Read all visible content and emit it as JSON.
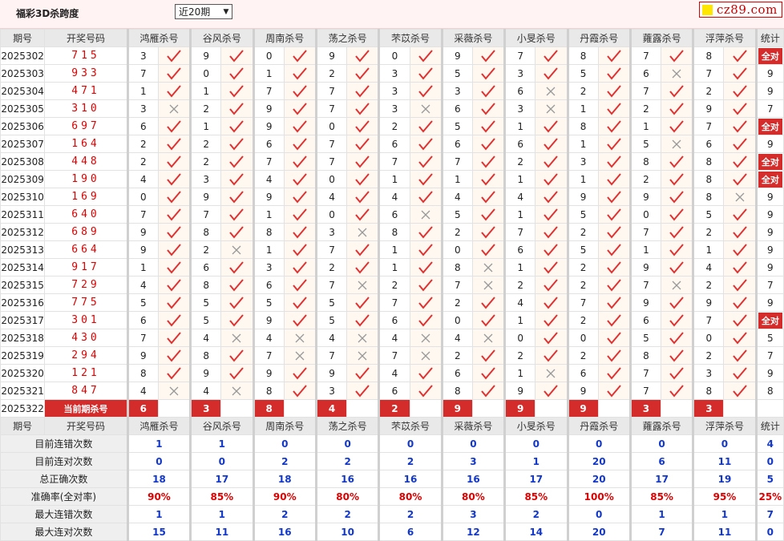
{
  "header": {
    "title": "福彩3D杀跨度",
    "period_select": "近20期",
    "logo_text": "cz89.com"
  },
  "columns": {
    "period": "期号",
    "draw": "开奖号码",
    "experts": [
      "鸿雁杀号",
      "谷风杀号",
      "周南杀号",
      "荡之杀号",
      "芣苡杀号",
      "采薇杀号",
      "小旻杀号",
      "丹霞杀号",
      "蕹露杀号",
      "浮萍杀号"
    ],
    "stat": "统计"
  },
  "rows": [
    {
      "period": "2025302",
      "draw": "715",
      "kills": [
        3,
        9,
        0,
        9,
        0,
        9,
        7,
        8,
        7,
        8
      ],
      "hits": [
        1,
        1,
        1,
        1,
        1,
        1,
        1,
        1,
        1,
        1
      ],
      "stat": "全对"
    },
    {
      "period": "2025303",
      "draw": "933",
      "kills": [
        7,
        0,
        1,
        2,
        3,
        5,
        3,
        5,
        6,
        7
      ],
      "hits": [
        1,
        1,
        1,
        1,
        1,
        1,
        1,
        1,
        0,
        1
      ],
      "stat": "9"
    },
    {
      "period": "2025304",
      "draw": "471",
      "kills": [
        1,
        1,
        7,
        7,
        3,
        3,
        6,
        2,
        7,
        2
      ],
      "hits": [
        1,
        1,
        1,
        1,
        1,
        1,
        0,
        1,
        1,
        1
      ],
      "stat": "9"
    },
    {
      "period": "2025305",
      "draw": "310",
      "kills": [
        3,
        2,
        9,
        7,
        3,
        6,
        3,
        1,
        2,
        9
      ],
      "hits": [
        0,
        1,
        1,
        1,
        0,
        1,
        0,
        1,
        1,
        1
      ],
      "stat": "7"
    },
    {
      "period": "2025306",
      "draw": "697",
      "kills": [
        6,
        1,
        9,
        0,
        2,
        5,
        1,
        8,
        1,
        7
      ],
      "hits": [
        1,
        1,
        1,
        1,
        1,
        1,
        1,
        1,
        1,
        1
      ],
      "stat": "全对"
    },
    {
      "period": "2025307",
      "draw": "164",
      "kills": [
        2,
        2,
        6,
        7,
        6,
        6,
        6,
        1,
        5,
        6
      ],
      "hits": [
        1,
        1,
        1,
        1,
        1,
        1,
        1,
        1,
        0,
        1
      ],
      "stat": "9"
    },
    {
      "period": "2025308",
      "draw": "448",
      "kills": [
        2,
        2,
        7,
        7,
        7,
        7,
        2,
        3,
        8,
        8
      ],
      "hits": [
        1,
        1,
        1,
        1,
        1,
        1,
        1,
        1,
        1,
        1
      ],
      "stat": "全对"
    },
    {
      "period": "2025309",
      "draw": "190",
      "kills": [
        4,
        3,
        4,
        0,
        1,
        1,
        1,
        1,
        2,
        8
      ],
      "hits": [
        1,
        1,
        1,
        1,
        1,
        1,
        1,
        1,
        1,
        1
      ],
      "stat": "全对"
    },
    {
      "period": "2025310",
      "draw": "169",
      "kills": [
        0,
        9,
        9,
        4,
        4,
        4,
        4,
        9,
        9,
        8
      ],
      "hits": [
        1,
        1,
        1,
        1,
        1,
        1,
        1,
        1,
        1,
        0
      ],
      "stat": "9"
    },
    {
      "period": "2025311",
      "draw": "640",
      "kills": [
        7,
        7,
        1,
        0,
        6,
        5,
        1,
        5,
        0,
        5
      ],
      "hits": [
        1,
        1,
        1,
        1,
        0,
        1,
        1,
        1,
        1,
        1
      ],
      "stat": "9"
    },
    {
      "period": "2025312",
      "draw": "689",
      "kills": [
        9,
        8,
        8,
        3,
        8,
        2,
        7,
        2,
        7,
        2
      ],
      "hits": [
        1,
        1,
        1,
        0,
        1,
        1,
        1,
        1,
        1,
        1
      ],
      "stat": "9"
    },
    {
      "period": "2025313",
      "draw": "664",
      "kills": [
        9,
        2,
        1,
        7,
        1,
        0,
        6,
        5,
        1,
        1
      ],
      "hits": [
        1,
        0,
        1,
        1,
        1,
        1,
        1,
        1,
        1,
        1
      ],
      "stat": "9"
    },
    {
      "period": "2025314",
      "draw": "917",
      "kills": [
        1,
        6,
        3,
        2,
        1,
        8,
        1,
        2,
        9,
        4
      ],
      "hits": [
        1,
        1,
        1,
        1,
        1,
        0,
        1,
        1,
        1,
        1
      ],
      "stat": "9"
    },
    {
      "period": "2025315",
      "draw": "729",
      "kills": [
        4,
        8,
        6,
        7,
        2,
        7,
        2,
        2,
        7,
        2
      ],
      "hits": [
        1,
        1,
        1,
        0,
        1,
        0,
        1,
        1,
        0,
        1
      ],
      "stat": "7"
    },
    {
      "period": "2025316",
      "draw": "775",
      "kills": [
        5,
        5,
        5,
        5,
        7,
        2,
        4,
        7,
        9,
        9
      ],
      "hits": [
        1,
        1,
        1,
        1,
        1,
        1,
        1,
        1,
        1,
        1
      ],
      "stat": "9"
    },
    {
      "period": "2025317",
      "draw": "301",
      "kills": [
        6,
        5,
        9,
        5,
        6,
        0,
        1,
        2,
        6,
        7
      ],
      "hits": [
        1,
        1,
        1,
        1,
        1,
        1,
        1,
        1,
        1,
        1
      ],
      "stat": "全对"
    },
    {
      "period": "2025318",
      "draw": "430",
      "kills": [
        7,
        4,
        4,
        4,
        4,
        4,
        0,
        0,
        5,
        0
      ],
      "hits": [
        1,
        0,
        0,
        0,
        0,
        0,
        1,
        1,
        1,
        1
      ],
      "stat": "5"
    },
    {
      "period": "2025319",
      "draw": "294",
      "kills": [
        9,
        8,
        7,
        7,
        7,
        2,
        2,
        2,
        8,
        2
      ],
      "hits": [
        1,
        1,
        0,
        0,
        0,
        1,
        1,
        1,
        1,
        1
      ],
      "stat": "7"
    },
    {
      "period": "2025320",
      "draw": "121",
      "kills": [
        8,
        9,
        9,
        9,
        4,
        6,
        1,
        6,
        7,
        3
      ],
      "hits": [
        1,
        1,
        1,
        1,
        1,
        1,
        0,
        1,
        1,
        1
      ],
      "stat": "9"
    },
    {
      "period": "2025321",
      "draw": "847",
      "kills": [
        4,
        4,
        8,
        3,
        6,
        8,
        9,
        9,
        7,
        8
      ],
      "hits": [
        0,
        0,
        1,
        1,
        1,
        1,
        1,
        1,
        1,
        1
      ],
      "stat": "8"
    }
  ],
  "current": {
    "period": "2025322",
    "label": "当前期杀号",
    "kills": [
      "6",
      "3",
      "8",
      "4",
      "2",
      "9",
      "9",
      "9",
      "3",
      "3"
    ]
  },
  "stats": [
    {
      "label": "目前连错次数",
      "values": [
        "1",
        "1",
        "0",
        "0",
        "0",
        "0",
        "0",
        "0",
        "0",
        "0"
      ],
      "total": "4",
      "red": false
    },
    {
      "label": "目前连对次数",
      "values": [
        "0",
        "0",
        "2",
        "2",
        "2",
        "3",
        "1",
        "20",
        "6",
        "11"
      ],
      "total": "0",
      "red": false
    },
    {
      "label": "总正确次数",
      "values": [
        "18",
        "17",
        "18",
        "16",
        "16",
        "16",
        "17",
        "20",
        "17",
        "19"
      ],
      "total": "5",
      "red": false
    },
    {
      "label": "准确率(全对率)",
      "values": [
        "90%",
        "85%",
        "90%",
        "80%",
        "80%",
        "80%",
        "85%",
        "100%",
        "85%",
        "95%"
      ],
      "total": "25%",
      "red": true
    },
    {
      "label": "最大连错次数",
      "values": [
        "1",
        "1",
        "2",
        "2",
        "2",
        "3",
        "2",
        "0",
        "1",
        "1"
      ],
      "total": "7",
      "red": false
    },
    {
      "label": "最大连对次数",
      "values": [
        "15",
        "11",
        "16",
        "10",
        "6",
        "12",
        "14",
        "20",
        "7",
        "11"
      ],
      "total": "0",
      "red": false
    }
  ],
  "colors": {
    "accent_red": "#d42b2b",
    "check": "#e03030",
    "cross": "#999999",
    "stat_blue": "#1338c9"
  },
  "icons": {
    "hit": "check-icon",
    "miss": "cross-icon"
  }
}
